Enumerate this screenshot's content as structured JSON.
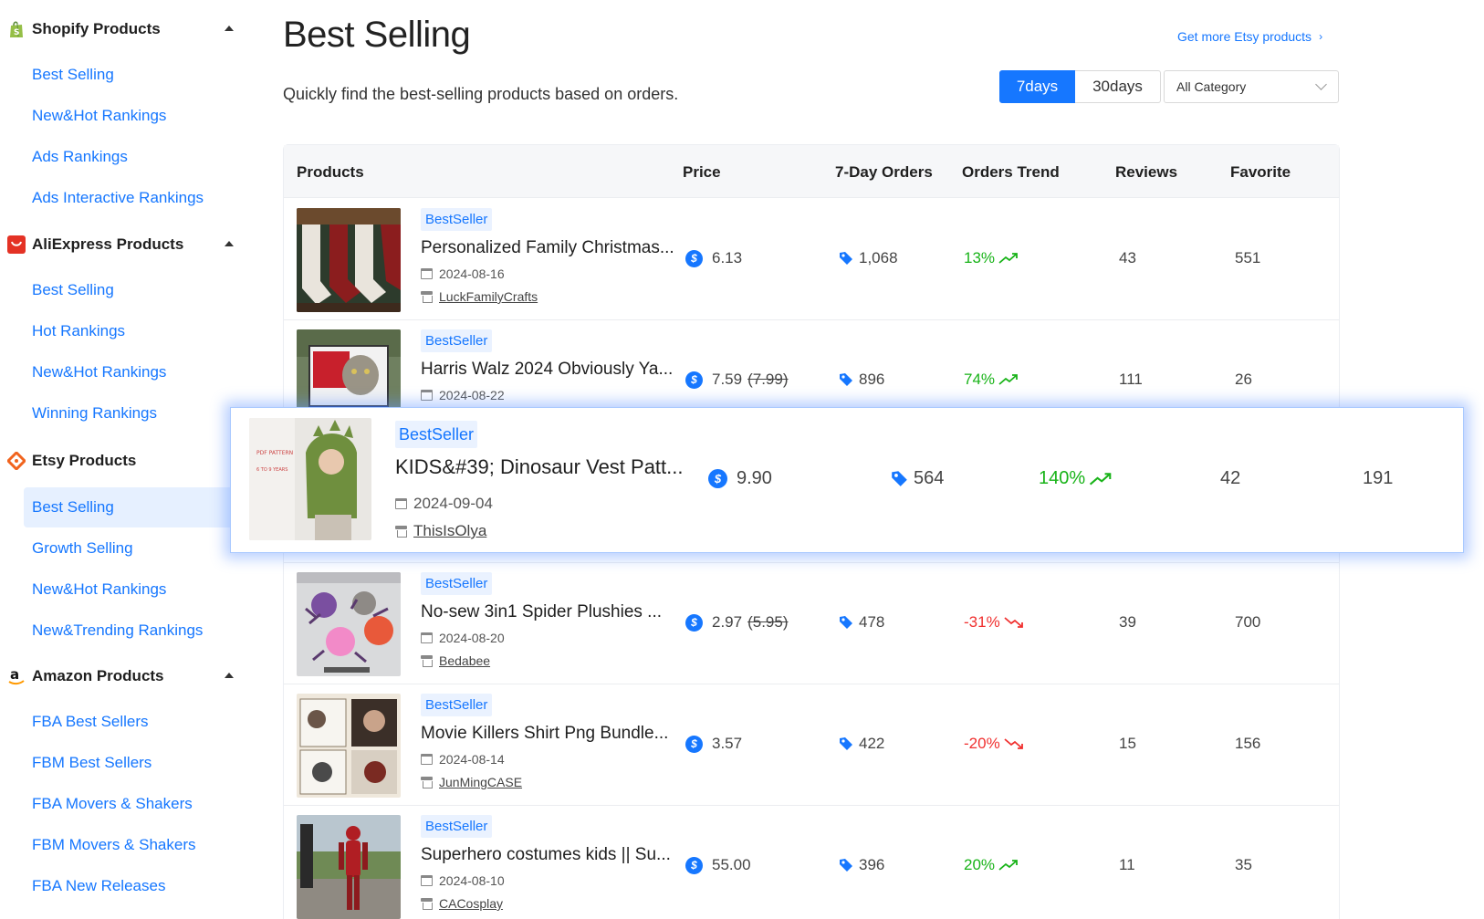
{
  "sidebar": {
    "groups": [
      {
        "title": "Shopify Products",
        "icon": "shopify-bag-icon",
        "items": [
          "Best Selling",
          "New&Hot Rankings",
          "Ads Rankings",
          "Ads Interactive Rankings"
        ]
      },
      {
        "title": "AliExpress Products",
        "icon": "aliexpress-icon",
        "items": [
          "Best Selling",
          "Hot Rankings",
          "New&Hot Rankings",
          "Winning Rankings"
        ]
      },
      {
        "title": "Etsy Products",
        "icon": "etsy-icon",
        "items": [
          "Best Selling",
          "Growth Selling",
          "New&Hot Rankings",
          "New&Trending Rankings"
        ]
      },
      {
        "title": "Amazon Products",
        "icon": "amazon-icon",
        "items": [
          "FBA Best Sellers",
          "FBM Best Sellers",
          "FBA Movers & Shakers",
          "FBM Movers & Shakers",
          "FBA New Releases"
        ]
      }
    ],
    "active": "Etsy Products / Best Selling"
  },
  "header": {
    "title": "Best Selling",
    "subtitle": "Quickly find the best-selling products based on orders.",
    "more_link": "Get more Etsy products",
    "range_tabs": [
      "7days",
      "30days"
    ],
    "active_range": "7days",
    "category": "All Category"
  },
  "table": {
    "columns": [
      "Products",
      "Price",
      "7-Day Orders",
      "Orders Trend",
      "Reviews",
      "Favorite"
    ],
    "rows": [
      {
        "badge": "BestSeller",
        "name": "Personalized Family Christmas...",
        "date": "2024-08-16",
        "shop": "LuckFamilyCrafts",
        "price": "6.13",
        "old_price": "",
        "orders": "1,068",
        "trend": "13%",
        "trend_dir": "up",
        "reviews": "43",
        "favorite": "551"
      },
      {
        "badge": "BestSeller",
        "name": "Harris Walz 2024 Obviously Ya...",
        "date": "2024-08-22",
        "shop": "",
        "price": "7.59",
        "old_price": "(7.99)",
        "orders": "896",
        "trend": "74%",
        "trend_dir": "up",
        "reviews": "111",
        "favorite": "26"
      },
      {
        "badge": "BestSeller",
        "name": "KIDS&#39; Dinosaur Vest Patt...",
        "date": "2024-09-04",
        "shop": "ThisIsOlya",
        "price": "9.90",
        "old_price": "",
        "orders": "564",
        "trend": "140%",
        "trend_dir": "up",
        "reviews": "42",
        "favorite": "191"
      },
      {
        "badge": "BestSeller",
        "name": "No-sew 3in1 Spider Plushies ...",
        "date": "2024-08-20",
        "shop": "Bedabee",
        "price": "2.97",
        "old_price": "(5.95)",
        "orders": "478",
        "trend": "-31%",
        "trend_dir": "down",
        "reviews": "39",
        "favorite": "700"
      },
      {
        "badge": "BestSeller",
        "name": "Movie Killers Shirt Png Bundle...",
        "date": "2024-08-14",
        "shop": "JunMingCASE",
        "price": "3.57",
        "old_price": "",
        "orders": "422",
        "trend": "-20%",
        "trend_dir": "down",
        "reviews": "15",
        "favorite": "156"
      },
      {
        "badge": "BestSeller",
        "name": "Superhero costumes kids || Su...",
        "date": "2024-08-10",
        "shop": "CACosplay",
        "price": "55.00",
        "old_price": "",
        "orders": "396",
        "trend": "20%",
        "trend_dir": "up",
        "reviews": "11",
        "favorite": "35"
      }
    ],
    "highlighted_row": 2
  },
  "colors": {
    "accent": "#1677ff",
    "trend_up": "#18b318",
    "trend_down": "#f0302f",
    "active_nav_bg": "#e6f0ff"
  }
}
